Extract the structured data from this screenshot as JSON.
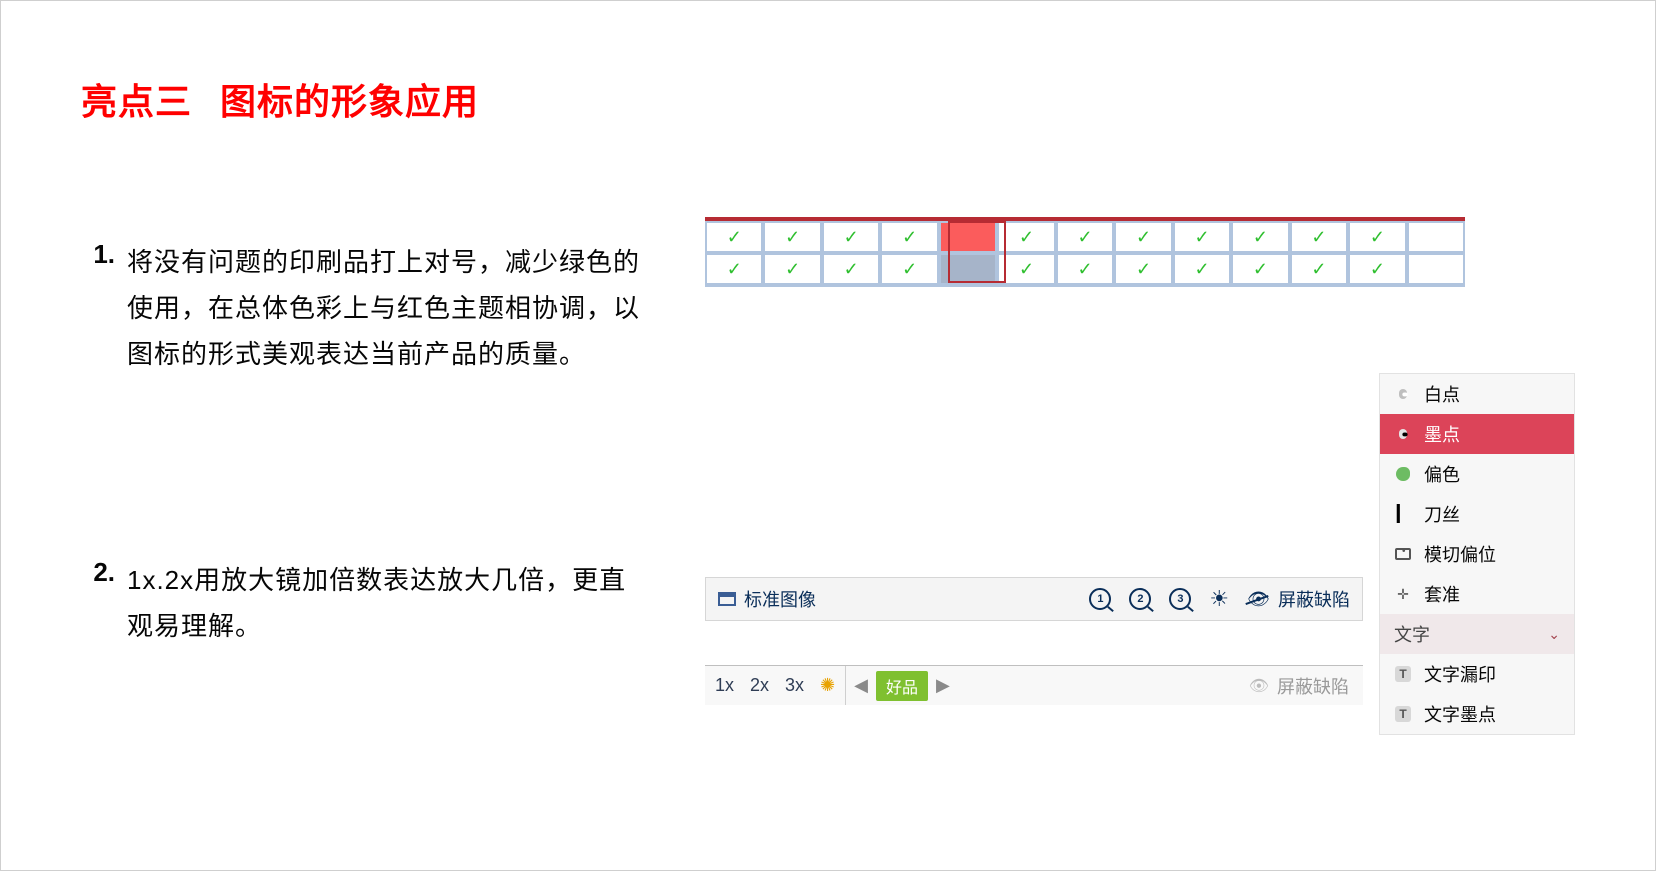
{
  "title_part1": "亮点三",
  "title_part2": "图标的形象应用",
  "items": [
    {
      "num": "1.",
      "text": "将没有问题的印刷品打上对号，减少绿色的使用，在总体色彩上与红色主题相协调，以图标的形式美观表达当前产品的质量。"
    },
    {
      "num": "2.",
      "text": "1x.2x用放大镜加倍数表达放大几倍，更直观易理解。"
    }
  ],
  "grid": {
    "cols": 13,
    "rows": [
      {
        "checks": [
          true,
          true,
          true,
          true,
          false,
          true,
          true,
          true,
          true,
          true,
          true,
          true,
          false
        ],
        "errorIndex": 4,
        "errorClass": "red"
      },
      {
        "checks": [
          true,
          true,
          true,
          true,
          false,
          true,
          true,
          true,
          true,
          true,
          true,
          true,
          false
        ],
        "errorIndex": 4,
        "errorClass": "grey"
      }
    ]
  },
  "defect_panel": {
    "items": [
      {
        "label": "白点",
        "icon": "dots-white",
        "active": false
      },
      {
        "label": "墨点",
        "icon": "dots-black",
        "active": true
      },
      {
        "label": "偏色",
        "icon": "green",
        "active": false
      },
      {
        "label": "刀丝",
        "icon": "knife",
        "active": false
      },
      {
        "label": "模切偏位",
        "icon": "diecut",
        "active": false
      },
      {
        "label": "套准",
        "icon": "reg",
        "active": false
      }
    ],
    "group_label": "文字",
    "sub": [
      {
        "label": "文字漏印",
        "glyph": "T"
      },
      {
        "label": "文字墨点",
        "glyph": "T"
      }
    ]
  },
  "toolbar1": {
    "std_image": "标准图像",
    "mag": [
      "1",
      "2",
      "3"
    ],
    "mask_defect": "屏蔽缺陷"
  },
  "toolbar2": {
    "zoom": [
      "1x",
      "2x",
      "3x"
    ],
    "good": "好品",
    "mask_defect": "屏蔽缺陷"
  }
}
